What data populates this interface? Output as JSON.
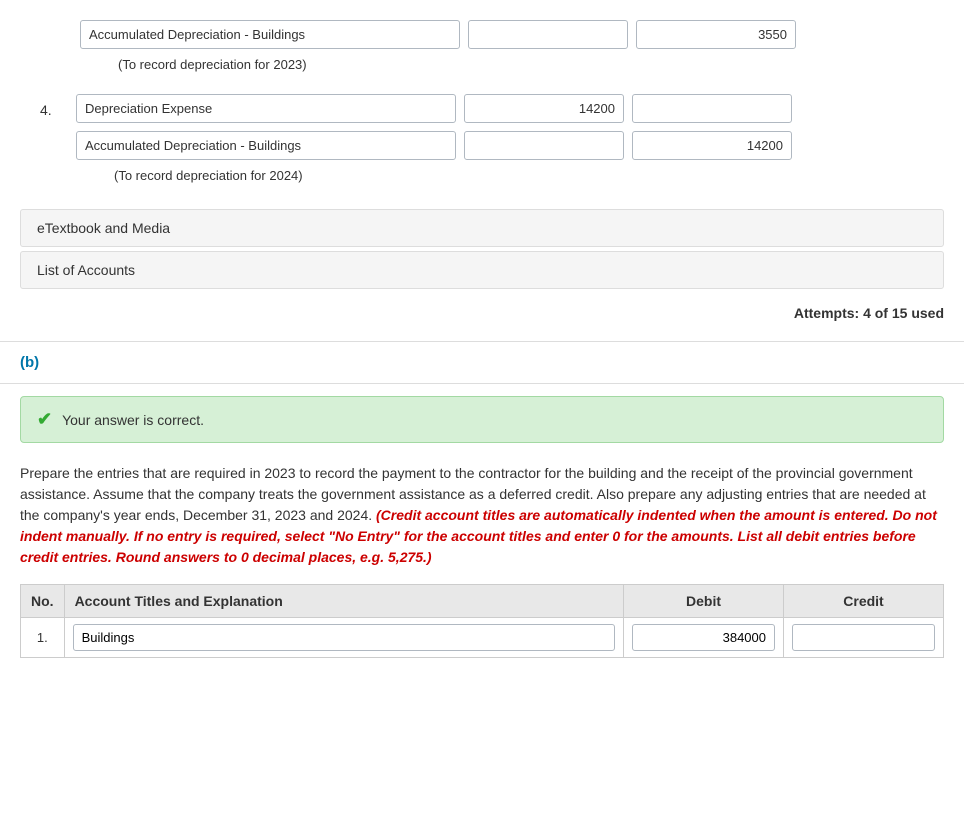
{
  "top_section": {
    "entries": [
      {
        "id": "entry-3",
        "num": null,
        "rows": [
          {
            "account": "Accumulated Depreciation - Buildings",
            "debit": "",
            "credit": "3550"
          }
        ],
        "note": "(To record depreciation for 2023)"
      },
      {
        "id": "entry-4",
        "num": "4.",
        "rows": [
          {
            "account": "Depreciation Expense",
            "debit": "14200",
            "credit": ""
          },
          {
            "account": "Accumulated Depreciation - Buildings",
            "debit": "",
            "credit": "14200"
          }
        ],
        "note": "(To record depreciation for 2024)"
      }
    ],
    "etextbook_label": "eTextbook and Media",
    "list_accounts_label": "List of Accounts",
    "attempts_label": "Attempts: 4 of 15 used"
  },
  "part_b": {
    "label": "(b)",
    "correct_message": "Your answer is correct.",
    "instruction_main": "Prepare the entries that are required in 2023 to record the payment to the contractor for the building and the receipt of the provincial government assistance. Assume that the company treats the government assistance as a deferred credit. Also prepare any adjusting entries that are needed at the company's year ends, December 31, 2023 and 2024.",
    "instruction_italic": "(Credit account titles are automatically indented when the amount is entered. Do not indent manually. If no entry is required, select \"No Entry\" for the account titles and enter 0 for the amounts. List all debit entries before credit entries. Round answers to 0 decimal places, e.g. 5,275.)",
    "table": {
      "headers": [
        "No.",
        "Account Titles and Explanation",
        "Debit",
        "Credit"
      ],
      "rows": [
        {
          "num": "1.",
          "account": "Buildings",
          "debit": "384000",
          "credit": ""
        }
      ]
    }
  }
}
